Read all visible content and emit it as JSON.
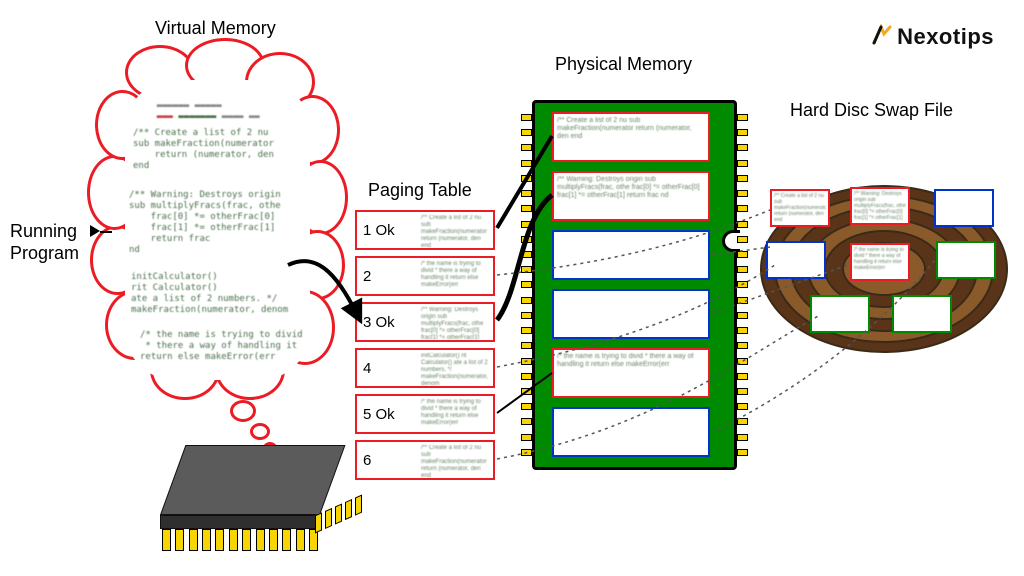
{
  "logo": {
    "brand": "Nexotips"
  },
  "labels": {
    "virtual_memory": "Virtual Memory",
    "physical_memory": "Physical Memory",
    "hard_disk": "Hard Disc Swap File",
    "paging_table": "Paging Table",
    "running_program": "Running\nProgram"
  },
  "paging_table": {
    "rows": [
      {
        "index": "1",
        "status": "Ok",
        "in_ram": true
      },
      {
        "index": "2",
        "status": "",
        "in_ram": false
      },
      {
        "index": "3",
        "status": "Ok",
        "in_ram": true
      },
      {
        "index": "4",
        "status": "",
        "in_ram": false
      },
      {
        "index": "5",
        "status": "Ok",
        "in_ram": true
      },
      {
        "index": "6",
        "status": "",
        "in_ram": false
      }
    ]
  },
  "ram": {
    "slots": [
      {
        "border": "red",
        "has_code": true
      },
      {
        "border": "red",
        "has_code": true
      },
      {
        "border": "blue",
        "has_code": false
      },
      {
        "border": "blue",
        "has_code": false
      },
      {
        "border": "red",
        "has_code": true
      },
      {
        "border": "blue",
        "has_code": false
      }
    ]
  },
  "disk": {
    "pages": [
      {
        "border": "red",
        "row": 0,
        "col": 0,
        "has_code": true
      },
      {
        "border": "red",
        "row": 0,
        "col": 1,
        "has_code": true
      },
      {
        "border": "blue",
        "row": 0,
        "col": 2,
        "has_code": false
      },
      {
        "border": "blue",
        "row": 1,
        "col": 0,
        "has_code": false
      },
      {
        "border": "red",
        "row": 1,
        "col": 1,
        "has_code": true
      },
      {
        "border": "green",
        "row": 1,
        "col": 2,
        "has_code": false
      },
      {
        "border": "green",
        "row": 2,
        "col": 0.6,
        "has_code": false
      },
      {
        "border": "green",
        "row": 2,
        "col": 1.6,
        "has_code": false
      }
    ]
  },
  "code_fragments": {
    "a": "/** Create a list of 2 nu\nsub makeFraction(numerator\n    return (numerator, den\nend",
    "b": "/** Warning: Destroys origin\nsub multiplyFracs(frac, othe\n    frac[0] *= otherFrac[0]\n    frac[1] *= otherFrac[1]\n    return frac\nnd",
    "c": "initCalculator()\nrit Calculator()\nate a list of 2 numbers. */\nmakeFraction(numerator, denom",
    "d": "/* the name is trying to divid\n * there a way of handling it\nreturn else makeError(err"
  }
}
